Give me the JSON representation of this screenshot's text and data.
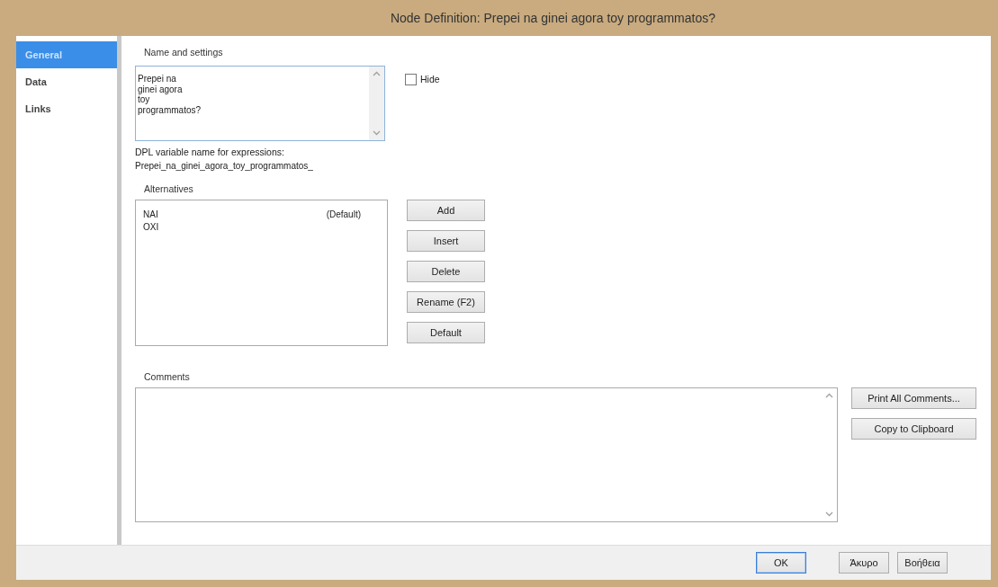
{
  "window": {
    "title": "Node Definition: Prepei na ginei agora toy programmatos?"
  },
  "sidebar": {
    "items": [
      {
        "label": "General",
        "selected": true
      },
      {
        "label": "Data",
        "selected": false
      },
      {
        "label": "Links",
        "selected": false
      }
    ]
  },
  "name_section": {
    "heading": "Name and settings",
    "name_value": "Prepei na\nginei agora\ntoy\nprogrammatos?",
    "hide": {
      "label": "Hide",
      "checked": false
    },
    "variable_label": "DPL variable name for expressions:",
    "variable_name": "Prepei_na_ginei_agora_toy_programmatos_"
  },
  "alternatives": {
    "heading": "Alternatives",
    "items": [
      {
        "label": "NAI",
        "tag": "(Default)"
      },
      {
        "label": "OXI"
      }
    ],
    "buttons": [
      "Add",
      "Insert",
      "Delete",
      "Rename (F2)",
      "Default"
    ]
  },
  "comments": {
    "heading": "Comments",
    "buttons": [
      "Print All Comments...",
      "Copy to Clipboard"
    ]
  },
  "footer": {
    "buttons": [
      {
        "label": "OK",
        "default": true
      },
      {
        "label": "Άκυρο",
        "default": false
      },
      {
        "label": "Βοήθεια",
        "default": false
      }
    ]
  }
}
